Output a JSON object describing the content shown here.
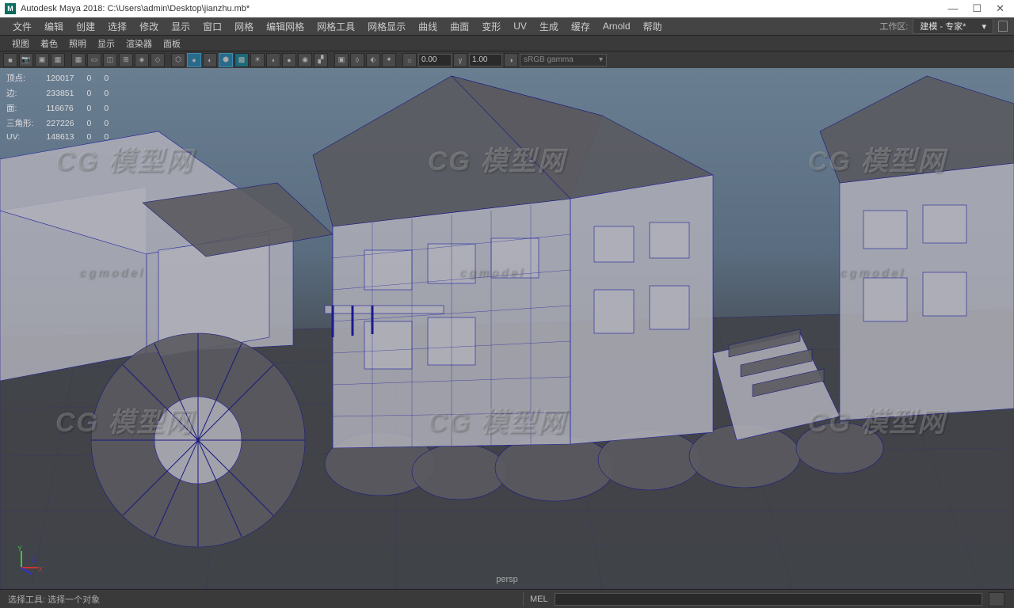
{
  "window": {
    "title": "Autodesk Maya 2018: C:\\Users\\admin\\Desktop\\jianzhu.mb*",
    "logo_letter": "M"
  },
  "menus": [
    "文件",
    "编辑",
    "创建",
    "选择",
    "修改",
    "显示",
    "窗口",
    "网格",
    "编辑网格",
    "网格工具",
    "网格显示",
    "曲线",
    "曲面",
    "变形",
    "UV",
    "生成",
    "缓存",
    "Arnold",
    "帮助"
  ],
  "workspace": {
    "label": "工作区:",
    "value": "建模 - 专家*"
  },
  "panel_menus": [
    "视图",
    "着色",
    "照明",
    "显示",
    "渲染器",
    "面板"
  ],
  "toolbar": {
    "val1": "0.00",
    "val2": "1.00",
    "dropdown": "sRGB gamma"
  },
  "hud": {
    "rows": [
      {
        "label": "顶点:",
        "a": "120017",
        "b": "0",
        "c": "0"
      },
      {
        "label": "边:",
        "a": "233851",
        "b": "0",
        "c": "0"
      },
      {
        "label": "面:",
        "a": "116676",
        "b": "0",
        "c": "0"
      },
      {
        "label": "三角形:",
        "a": "227226",
        "b": "0",
        "c": "0"
      },
      {
        "label": "UV:",
        "a": "148613",
        "b": "0",
        "c": "0"
      }
    ],
    "camera": "persp"
  },
  "status": {
    "text": "选择工具: 选择一个对象",
    "cmd_label": "MEL"
  },
  "watermark": "CG 模型网",
  "watermark_small": "cgmodel"
}
